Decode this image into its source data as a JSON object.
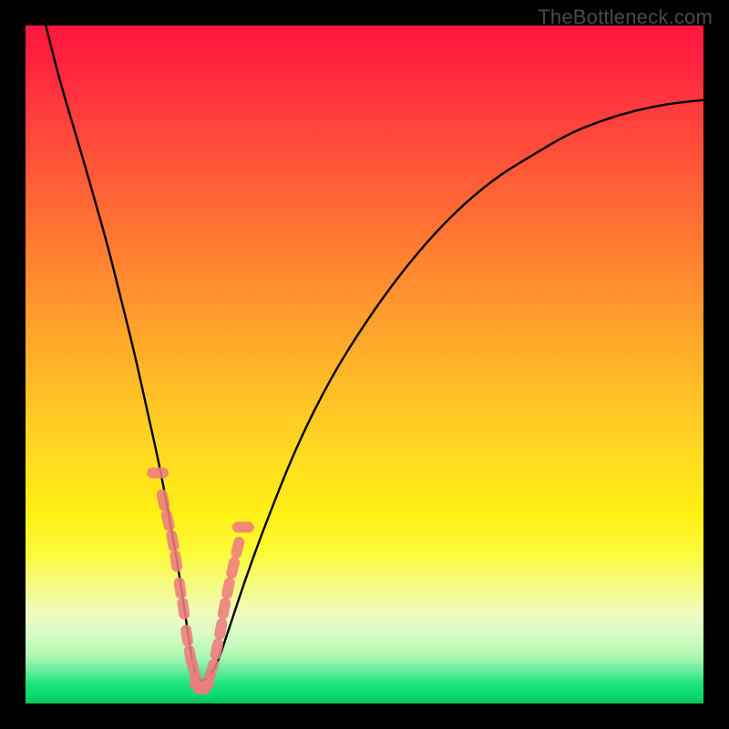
{
  "watermark": "TheBottleneck.com",
  "colors": {
    "frame": "#000000",
    "curve": "#000000",
    "markers": "#ed7c7e",
    "gradient_top": "#ff163f",
    "gradient_bottom": "#07c05e"
  },
  "chart_data": {
    "type": "line",
    "title": "",
    "xlabel": "",
    "ylabel": "",
    "xlim": [
      0,
      100
    ],
    "ylim": [
      0,
      100
    ],
    "grid": false,
    "legend": false,
    "annotations": [
      "TheBottleneck.com"
    ],
    "series": [
      {
        "name": "bottleneck-curve",
        "x": [
          3,
          5,
          8,
          10,
          12,
          14,
          16,
          18,
          20,
          22,
          23,
          24,
          25,
          26,
          28,
          30,
          33,
          36,
          40,
          45,
          50,
          55,
          60,
          65,
          70,
          75,
          80,
          85,
          90,
          95,
          100
        ],
        "y": [
          100,
          92,
          82,
          75,
          68,
          60,
          52,
          43,
          34,
          23,
          17,
          10,
          4,
          3,
          5,
          11,
          20,
          28,
          38,
          48,
          56,
          63,
          69,
          74,
          78,
          81,
          84,
          86,
          87.5,
          88.5,
          89
        ]
      }
    ],
    "markers": {
      "name": "highlight-points",
      "x": [
        19.5,
        20.3,
        21.0,
        21.7,
        22.2,
        22.8,
        23.3,
        23.8,
        24.3,
        24.8,
        25.3,
        25.7,
        26.3,
        26.7,
        27.5,
        28.2,
        28.8,
        29.3,
        29.9,
        30.6,
        31.3,
        32.1
      ],
      "y": [
        34,
        30,
        27,
        24,
        21,
        17,
        14,
        10,
        7,
        5,
        3,
        2.5,
        2.5,
        3,
        5,
        8,
        11,
        14,
        17,
        20,
        23,
        26
      ]
    }
  }
}
